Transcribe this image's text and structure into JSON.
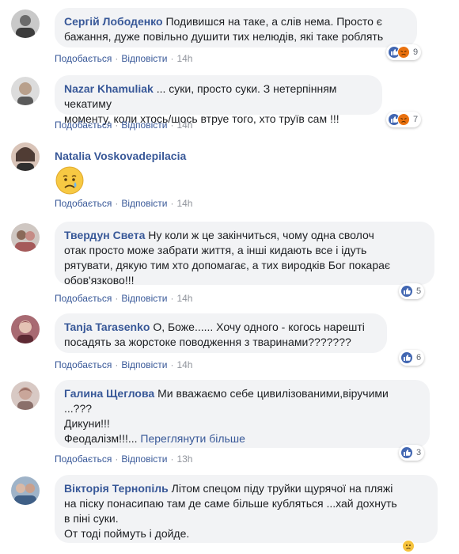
{
  "action_like": "Подобається",
  "action_reply": "Відповісти",
  "comments": [
    {
      "author": "Сергій Лободенко",
      "text": "Подивишся на таке, а слів нема. Просто є\nбажання, дуже повільно душити тих нелюдів, які таке роблять",
      "time": "14h",
      "reaction_count": "9",
      "reactions": [
        "like-icon",
        "angry-icon"
      ]
    },
    {
      "author": "Nazar Khamuliak",
      "text": "... суки, просто суки. З нетерпінням чекатиму\nмоменту, коли хтось/щось втруе того, хто труїв сам !!!",
      "time": "14h",
      "reaction_count": "7",
      "reactions": [
        "like-icon",
        "angry-icon"
      ]
    },
    {
      "author": "Natalia Voskovadepilacia",
      "text": "",
      "emoji": "crying-face-icon",
      "time": "14h"
    },
    {
      "author": "Твердун Света",
      "text": "Ну коли ж це закінчиться, чому одна сволоч\nотак просто може забрати життя, а інші кидають все і ідуть\nрятувати, дякую тим хто допомагає, а тих виродків Бог покарає\nобов'язково!!!",
      "time": "14h",
      "reaction_count": "5",
      "reactions": [
        "like-icon"
      ]
    },
    {
      "author": "Tanja Tarasenko",
      "text": "О, Боже...... Хочу одного - когось нарешті\nпосадять за жорстоке поводження з тваринами???????",
      "time": "14h",
      "reaction_count": "6",
      "reactions": [
        "like-icon"
      ]
    },
    {
      "author": "Галина Щеглова",
      "text": "Ми вважаємо себе цивилізованими,віручими\n...???\nДикуни!!!\nФеодалізм!!!...",
      "see_more": "Переглянути більше",
      "time": "13h",
      "reaction_count": "3",
      "reactions": [
        "like-icon"
      ]
    },
    {
      "author": "Вікторія Тернопіль",
      "text": "Літом спецом піду труйки щурячої на пляжі\nна піску понасипаю там де саме більше кубляться ...хай дохнуть\nв піні суки.\nОт тоді поймуть і дойде.",
      "reactions": [
        "sad-icon"
      ]
    }
  ],
  "colors": {
    "author": "#385898",
    "bubble": "#f2f3f5",
    "meta": "#90949c",
    "like": "#4267b2",
    "angry": "#e9710f",
    "sad": "#f6c33d"
  }
}
